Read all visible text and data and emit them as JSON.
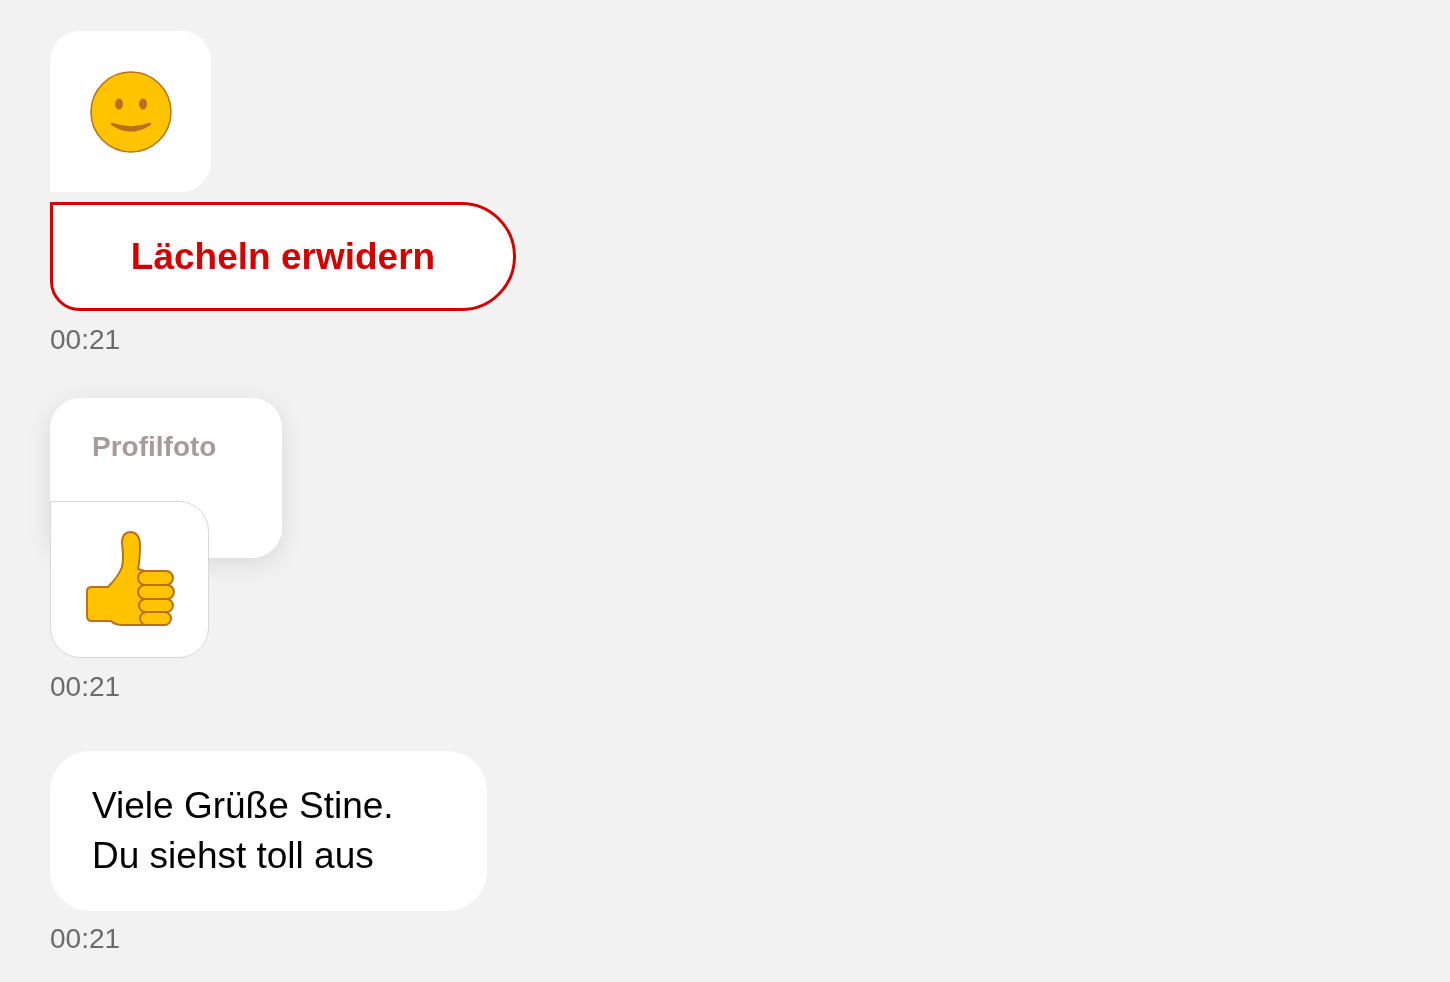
{
  "messages": [
    {
      "kind": "smile",
      "reply_button": "Lächeln erwidern",
      "time": "00:21"
    },
    {
      "kind": "photo",
      "label": "Profilfoto",
      "time": "00:21"
    },
    {
      "kind": "text",
      "text": "Viele Grüße Stine.\nDu siehst toll aus",
      "time": "00:21"
    }
  ]
}
